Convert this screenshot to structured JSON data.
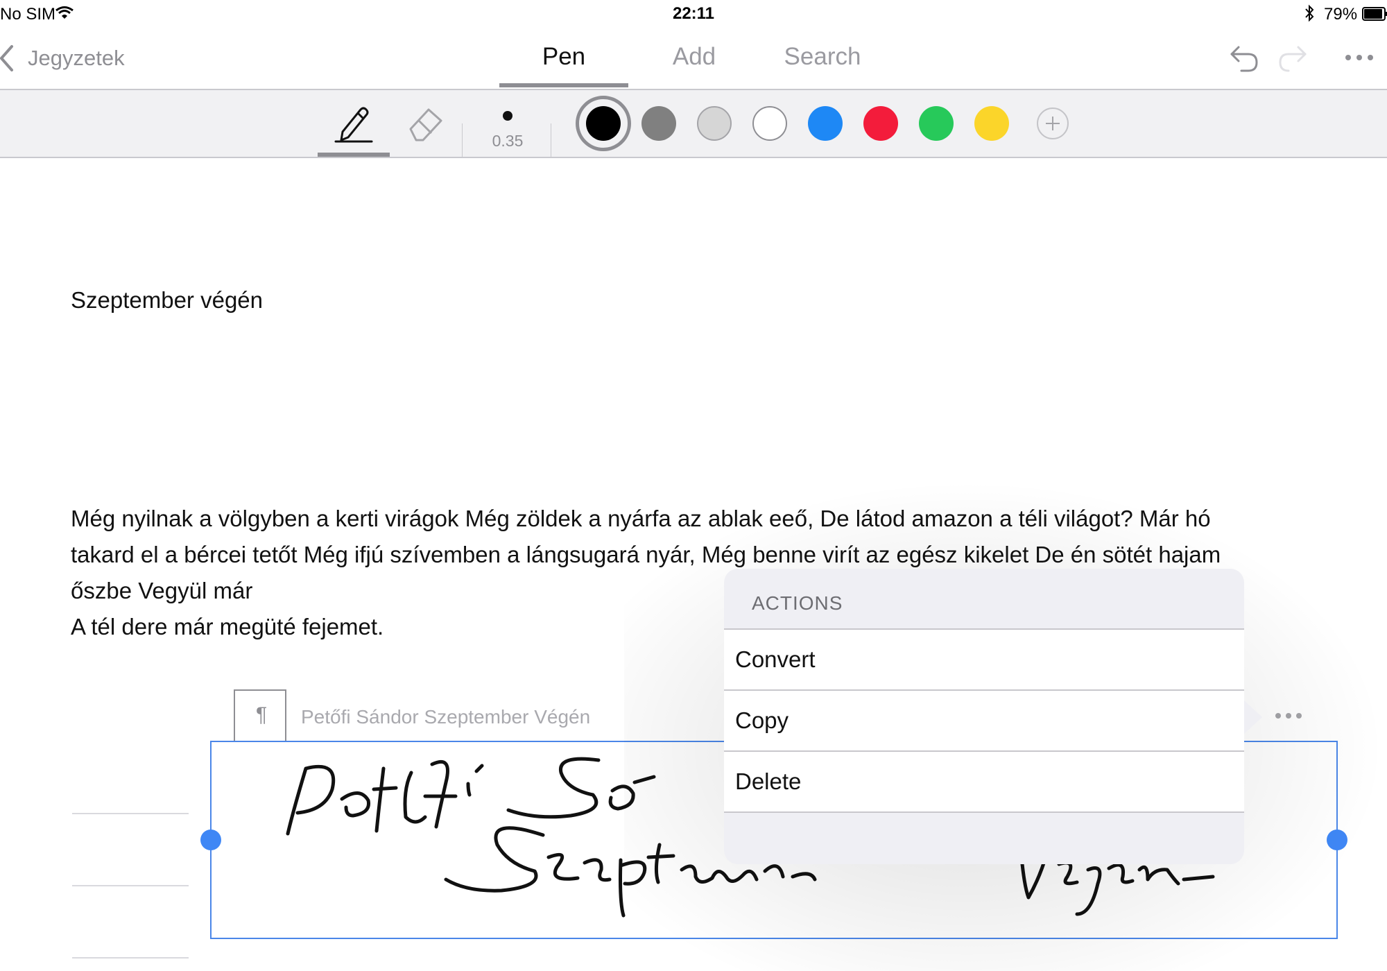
{
  "status_bar": {
    "carrier": "No SIM",
    "time": "22:11",
    "battery": "79%"
  },
  "nav": {
    "back_label": "Jegyzetek",
    "tabs": [
      "Pen",
      "Add",
      "Search"
    ],
    "active_tab": "Pen"
  },
  "pen_toolbar": {
    "stroke_size": "0.35",
    "colors": [
      "#000000",
      "#808080",
      "#d6d6d6",
      "#ffffff",
      "#1e88f5",
      "#f31c3b",
      "#27c95a",
      "#fbd52a"
    ],
    "selected_color": "#000000"
  },
  "document": {
    "title": "Szeptember végén",
    "paragraph_lines": [
      "Még nyilnak a völgyben a kerti virágok Még zöldek a nyárfa az ablak eeő, De látod amazon a téli világot? Már hó",
      "takard el a bércei tetőt Még ifjú szívemben a lángsugará nyár, Még benne virít az egész kikelet De én sötét hajam",
      "őszbe Vegyül már",
      "A tél dere már megüté fejemet."
    ]
  },
  "ink_block": {
    "paragraph_glyph": "¶",
    "caption": "Petőfi Sándor Szeptember Végén"
  },
  "actions_popover": {
    "title": "ACTIONS",
    "items": [
      "Convert",
      "Copy",
      "Delete"
    ]
  }
}
